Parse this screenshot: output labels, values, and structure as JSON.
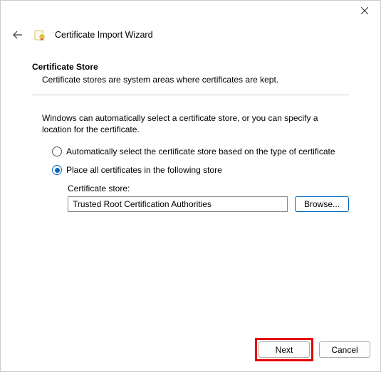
{
  "window": {
    "title": "Certificate Import Wizard"
  },
  "section": {
    "title": "Certificate Store",
    "description": "Certificate stores are system areas where certificates are kept."
  },
  "body": {
    "intro": "Windows can automatically select a certificate store, or you can specify a location for the certificate."
  },
  "radios": {
    "auto": "Automatically select the certificate store based on the type of certificate",
    "manual": "Place all certificates in the following store"
  },
  "store": {
    "label": "Certificate store:",
    "value": "Trusted Root Certification Authorities",
    "browse": "Browse..."
  },
  "buttons": {
    "next": "Next",
    "cancel": "Cancel"
  }
}
